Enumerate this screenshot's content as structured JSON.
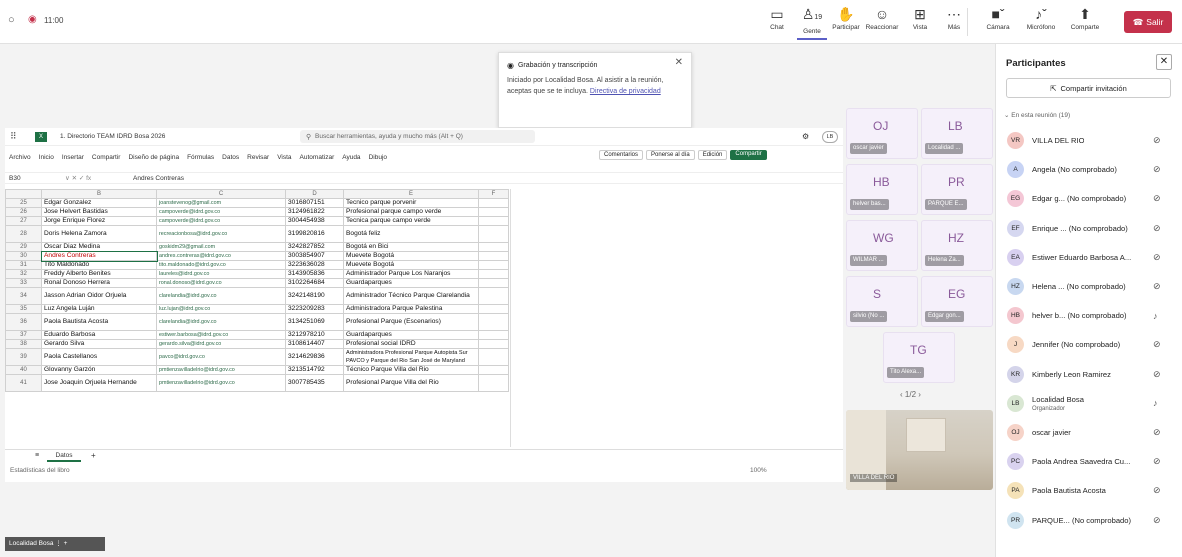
{
  "window": {
    "time": "11:00"
  },
  "toolbar": {
    "chat": "Chat",
    "people_count": "19",
    "people": "Gente",
    "raise": "Participar",
    "react": "Reaccionar",
    "view": "Vista",
    "more": "Más",
    "camera": "Cámara",
    "mic": "Micrófono",
    "share": "Comparte",
    "leave": "Salir"
  },
  "toast": {
    "title": "Grabación y transcripción",
    "body": "Iniciado por Localidad Bosa. Al asistir a la reunión, aceptas que se te incluya.",
    "link": "Directiva de privacidad"
  },
  "excel": {
    "doc_title": "1. Directorio TEAM IDRD Bosa 2026",
    "search_placeholder": "Buscar herramientas, ayuda y mucho más (Alt + Q)",
    "avatar": "LB",
    "menu": [
      "Archivo",
      "Inicio",
      "Insertar",
      "Compartir",
      "Diseño de página",
      "Fórmulas",
      "Datos",
      "Revisar",
      "Vista",
      "Automatizar",
      "Ayuda",
      "Dibujo"
    ],
    "comments": "Comentarios",
    "catchup": "Ponerse al día",
    "editing": "Edición",
    "share": "Compartir",
    "cell_ref": "B30",
    "formula_value": "Andres Contreras",
    "columns": [
      "A",
      "B",
      "C",
      "D",
      "E",
      "F"
    ],
    "rows": [
      {
        "n": "25",
        "b": "Edgar Gonzalez",
        "c": "joanstevenog@gmail.com",
        "d": "3016807151",
        "e": "Tecnico parque porvenir"
      },
      {
        "n": "26",
        "b": "Jose Helvert Bastidas",
        "c": "campoverde@idrd.gov.co",
        "d": "3124961822",
        "e": "Profesional parque campo verde"
      },
      {
        "n": "27",
        "b": "Jorge Enrique Florez",
        "c": "campoverde@idrd.gov.co",
        "d": "3004454938",
        "e": "Tecnica parque campo verde"
      },
      {
        "n": "28",
        "b": "Doris Helena Zamora",
        "c": "recreacionbosa@idrd.gov.co",
        "d": "3199820816",
        "e": "Bogotá feliz"
      },
      {
        "n": "29",
        "b": "Oscar Diaz Medina",
        "c": "goskidm29@gmail.com",
        "d": "3242827852",
        "e": "Bogotá en Bici"
      },
      {
        "n": "30",
        "b": "Andres Contreras",
        "c": "andres.contreras@idrd.gov.co",
        "d": "3003854907",
        "e": "Muevete Bogotá"
      },
      {
        "n": "31",
        "b": "Tito Maldonado",
        "c": "tito.maldonado@idrd.gov.co",
        "d": "3223636028",
        "e": "Muevete Bogotá"
      },
      {
        "n": "32",
        "b": "Freddy Alberto Benites",
        "c": "laureles@idrd.gov.co",
        "d": "3143905836",
        "e": "Administrador Parque Los Naranjos"
      },
      {
        "n": "33",
        "b": "Ronal Donoso Herrera",
        "c": "ronal.donoso@idrd.gov.co",
        "d": "3102264684",
        "e": "Guardaparques"
      },
      {
        "n": "34",
        "b": "Jasson Adrian Oidor Orjuela",
        "c": "clarelandia@idrd.gov.co",
        "d": "3242148190",
        "e": "Administrador Técnico Parque Clarelandia"
      },
      {
        "n": "35",
        "b": "Luz Angela Luján",
        "c": "luz.lujan@idrd.gov.co",
        "d": "3223209283",
        "e": "Administradora Parque Palestina"
      },
      {
        "n": "36",
        "b": "Paola Bautista Acosta",
        "c": "clarelandia@idrd.gov.co",
        "d": "3134251069",
        "e": "Profesional Parque (Escenarios)"
      },
      {
        "n": "37",
        "b": "Eduardo Barbosa",
        "c": "estiwer.barbosa@idrd.gov.co",
        "d": "3212978210",
        "e": "Guardaparques"
      },
      {
        "n": "38",
        "b": "Gerardo Silva",
        "c": "gerardo.silva@idrd.gov.co",
        "d": "3108614407",
        "e": "Profesional social IDRD"
      },
      {
        "n": "39",
        "b": "Paola Castellanos",
        "c": "pavco@idrd.gov.co",
        "d": "3214629836",
        "e": "Administradora Profesional Parque Autopista Sur PAVCO y Parque del Rio San José de Maryland"
      },
      {
        "n": "40",
        "b": "Glovanny Garzón",
        "c": "pmtienzavilladelrio@idrd.gov.co",
        "d": "3213514792",
        "e": "Técnico Parque Villa del Rio"
      },
      {
        "n": "41",
        "b": "Jose Joaquin Orjuela Hernande",
        "c": "pmtienzavilladelrio@idrd.gov.co",
        "d": "3007785435",
        "e": "Profesional Parque Villa del Rio"
      }
    ],
    "sheet_tab": "Datos",
    "status": "Estadísticas del libro",
    "zoom": "100%"
  },
  "tiles": [
    {
      "initials": "OJ",
      "name": "oscar javier"
    },
    {
      "initials": "LB",
      "name": "Localidad ..."
    },
    {
      "initials": "HB",
      "name": "helver bas..."
    },
    {
      "initials": "PR",
      "name": "PARQUE E..."
    },
    {
      "initials": "WG",
      "name": "WILMAR ..."
    },
    {
      "initials": "HZ",
      "name": "Helena Za..."
    },
    {
      "initials": "S",
      "name": "silvio (No ..."
    },
    {
      "initials": "EG",
      "name": "Edgar gon..."
    },
    {
      "initials": "TG",
      "name": "Tito Alexa..."
    }
  ],
  "pager": "1/2",
  "video_label": "VILLA DEL RIO",
  "self_label": "Localidad Bosa",
  "panel": {
    "title": "Participantes",
    "share_invite": "Compartir invitación",
    "section": "En esta reunión (19)",
    "people": [
      {
        "i": "VR",
        "name": "VILLA DEL RIO",
        "sub": ""
      },
      {
        "i": "A",
        "name": "Angela (No comprobado)",
        "sub": ""
      },
      {
        "i": "EG",
        "name": "Edgar g... (No comprobado)",
        "sub": ""
      },
      {
        "i": "EF",
        "name": "Enrique ... (No comprobado)",
        "sub": ""
      },
      {
        "i": "EA",
        "name": "Estiwer Eduardo Barbosa A...",
        "sub": ""
      },
      {
        "i": "HZ",
        "name": "Helena ... (No comprobado)",
        "sub": ""
      },
      {
        "i": "HB",
        "name": "helver b... (No comprobado)",
        "sub": ""
      },
      {
        "i": "J",
        "name": "Jennifer (No comprobado)",
        "sub": ""
      },
      {
        "i": "KR",
        "name": "Kimberly Leon Ramirez",
        "sub": ""
      },
      {
        "i": "LB",
        "name": "Localidad Bosa",
        "sub": "Organizador"
      },
      {
        "i": "OJ",
        "name": "oscar javier",
        "sub": ""
      },
      {
        "i": "PC",
        "name": "Paola Andrea Saavedra Cu...",
        "sub": ""
      },
      {
        "i": "PA",
        "name": "Paola Bautista Acosta",
        "sub": ""
      },
      {
        "i": "PR",
        "name": "PARQUE... (No comprobado)",
        "sub": ""
      }
    ]
  }
}
